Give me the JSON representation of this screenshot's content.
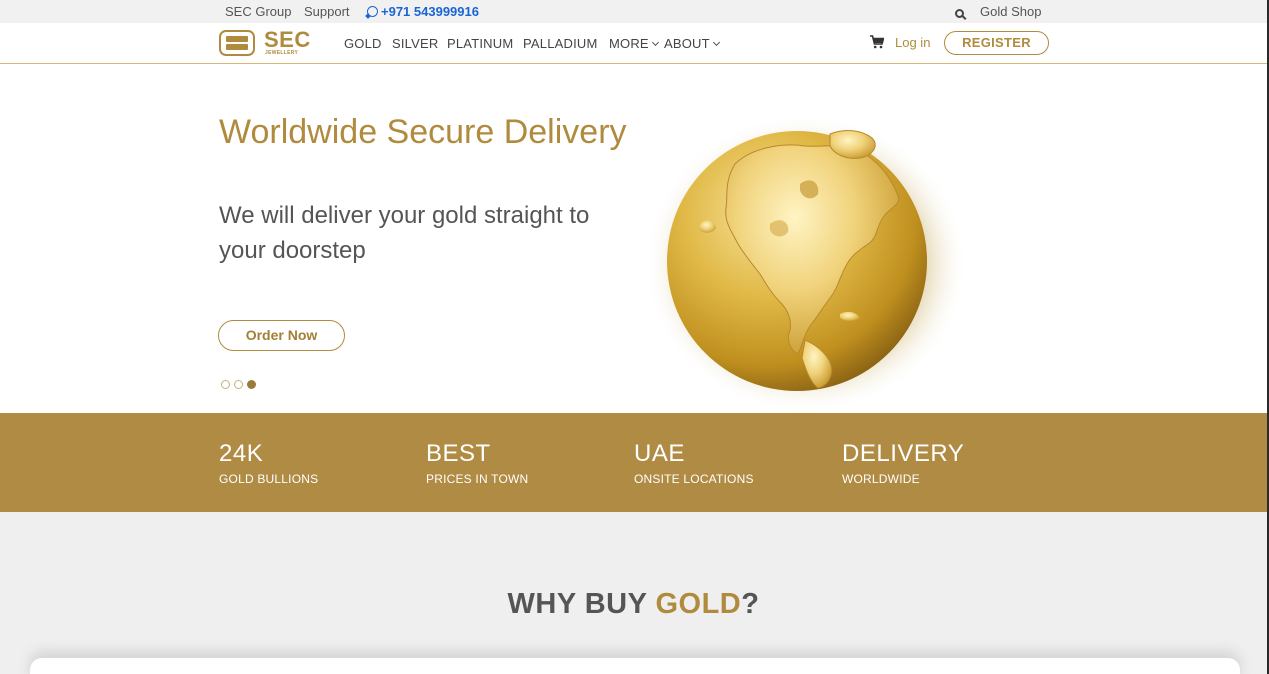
{
  "topbar": {
    "group": "SEC Group",
    "support": "Support",
    "phone": "+971 543999916",
    "shop": "Gold Shop"
  },
  "nav": {
    "logo_text": "SEC",
    "logo_sub": "JEWELLERY",
    "items": [
      "GOLD",
      "SILVER",
      "PLATINUM",
      "PALLADIUM",
      "MORE",
      "ABOUT"
    ],
    "login": "Log in",
    "register": "REGISTER"
  },
  "hero": {
    "title": "Worldwide Secure Delivery",
    "subtitle": "We will deliver your gold straight to your doorstep",
    "cta": "Order Now",
    "slides": 3,
    "active_slide": 3
  },
  "stats": [
    {
      "big": "24K",
      "small": "GOLD BULLIONS"
    },
    {
      "big": "BEST",
      "small": "PRICES IN TOWN"
    },
    {
      "big": "UAE",
      "small": "ONSITE LOCATIONS"
    },
    {
      "big": "DELIVERY",
      "small": "WORLDWIDE"
    }
  ],
  "why": {
    "prefix": "WHY BUY ",
    "highlight": "GOLD",
    "suffix": "?"
  },
  "colors": {
    "gold": "#b08b3e",
    "band": "#b08b44",
    "phone": "#1a64d8",
    "section_bg": "#efefef"
  },
  "icons": [
    "whatsapp-icon",
    "search-icon",
    "cart-icon",
    "chevron-down-icon",
    "globe-image"
  ]
}
